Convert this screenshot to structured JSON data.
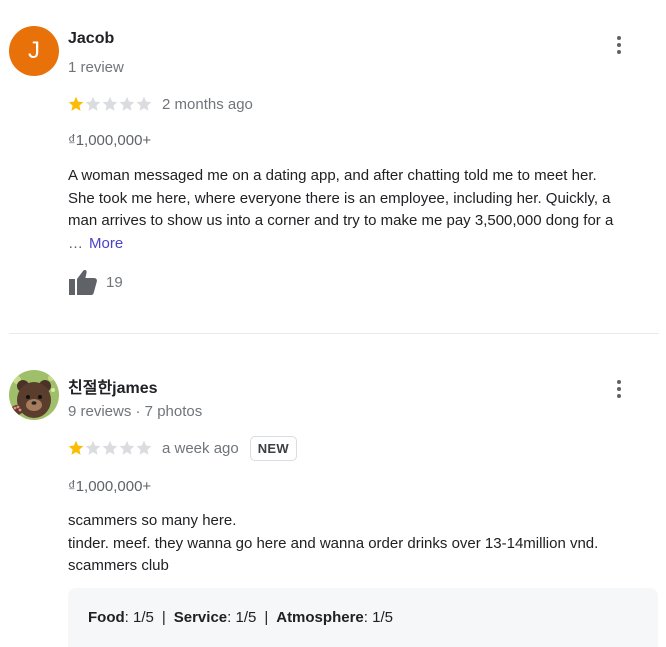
{
  "reviews": [
    {
      "author": "Jacob",
      "avatar_letter": "J",
      "avatar_color": "#e8710a",
      "meta": "1 review",
      "rating": 1,
      "rating_max": 5,
      "date": "2 months ago",
      "price": "₫1,000,000+",
      "text_lines": [
        "A woman messaged me on a dating app, and after chatting told me to meet her.",
        "She took me here, where everyone there is an employee, including her. Quickly, a",
        "man arrives to show us into a corner and try to make me pay 3,500,000 dong for a"
      ],
      "ellipsis": "…",
      "more_label": "More",
      "likes": "19"
    },
    {
      "author": "친절한james",
      "meta": "9 reviews · 7 photos",
      "rating": 1,
      "rating_max": 5,
      "date": "a week ago",
      "badge": "NEW",
      "price": "₫1,000,000+",
      "text_lines": [
        "scammers so many here.",
        "tinder. meef. they wanna go here and wanna order drinks over 13-14million vnd.",
        "scammers club"
      ],
      "attributes": [
        {
          "label": "Food",
          "value": ": 1/5"
        },
        {
          "label": "Service",
          "value": ": 1/5"
        },
        {
          "label": "Atmosphere",
          "value": ": 1/5"
        }
      ],
      "attribute_separator": "|"
    }
  ],
  "colors": {
    "star_filled": "#fbbc04",
    "star_empty": "#dadce0",
    "more_link": "#4a43c9"
  },
  "icons": {
    "menu": "more-vert-icon",
    "like": "thumb-up-icon",
    "star": "star-icon"
  }
}
